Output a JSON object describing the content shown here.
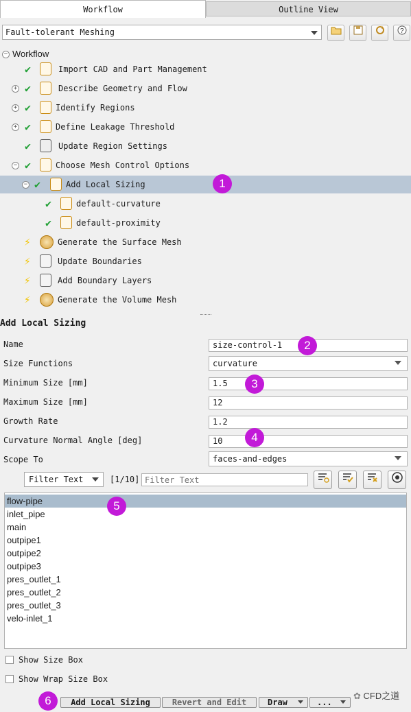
{
  "tabs": {
    "workflow": "Workflow",
    "outline": "Outline View"
  },
  "workflow_select": "Fault-tolerant Meshing",
  "tree": {
    "root": "Workflow",
    "items": [
      {
        "label": "Import CAD and Part Management"
      },
      {
        "label": "Describe Geometry and Flow"
      },
      {
        "label": "Identify Regions"
      },
      {
        "label": "Define Leakage Threshold"
      },
      {
        "label": "Update Region Settings"
      },
      {
        "label": "Choose Mesh Control Options"
      },
      {
        "label": "Add Local Sizing"
      },
      {
        "label": "default-curvature"
      },
      {
        "label": "default-proximity"
      },
      {
        "label": "Generate the Surface Mesh"
      },
      {
        "label": "Update Boundaries"
      },
      {
        "label": "Add Boundary Layers"
      },
      {
        "label": "Generate the Volume Mesh"
      }
    ]
  },
  "panel": {
    "title": "Add Local Sizing",
    "name_label": "Name",
    "name_value": "size-control-1",
    "sizefn_label": "Size Functions",
    "sizefn_value": "curvature",
    "min_label": "Minimum Size [mm]",
    "min_value": "1.5",
    "max_label": "Maximum Size [mm]",
    "max_value": "12",
    "growth_label": "Growth Rate",
    "growth_value": "1.2",
    "angle_label": "Curvature Normal Angle [deg]",
    "angle_value": "10",
    "scope_label": "Scope To",
    "scope_value": "faces-and-edges"
  },
  "filter": {
    "dropdown": "Filter Text",
    "count": "[1/10]",
    "placeholder": "Filter Text"
  },
  "list_items": [
    "flow-pipe",
    "inlet_pipe",
    "main",
    "outpipe1",
    "outpipe2",
    "outpipe3",
    "pres_outlet_1",
    "pres_outlet_2",
    "pres_outlet_3",
    "velo-inlet_1"
  ],
  "options": {
    "show_size_box": "Show Size Box",
    "show_wrap": "Show Wrap Size Box"
  },
  "buttons": {
    "add": "Add Local Sizing",
    "revert": "Revert and Edit",
    "draw": "Draw",
    "more": "..."
  },
  "badges": [
    "1",
    "2",
    "3",
    "4",
    "5",
    "6"
  ],
  "watermark": "CFD之道"
}
